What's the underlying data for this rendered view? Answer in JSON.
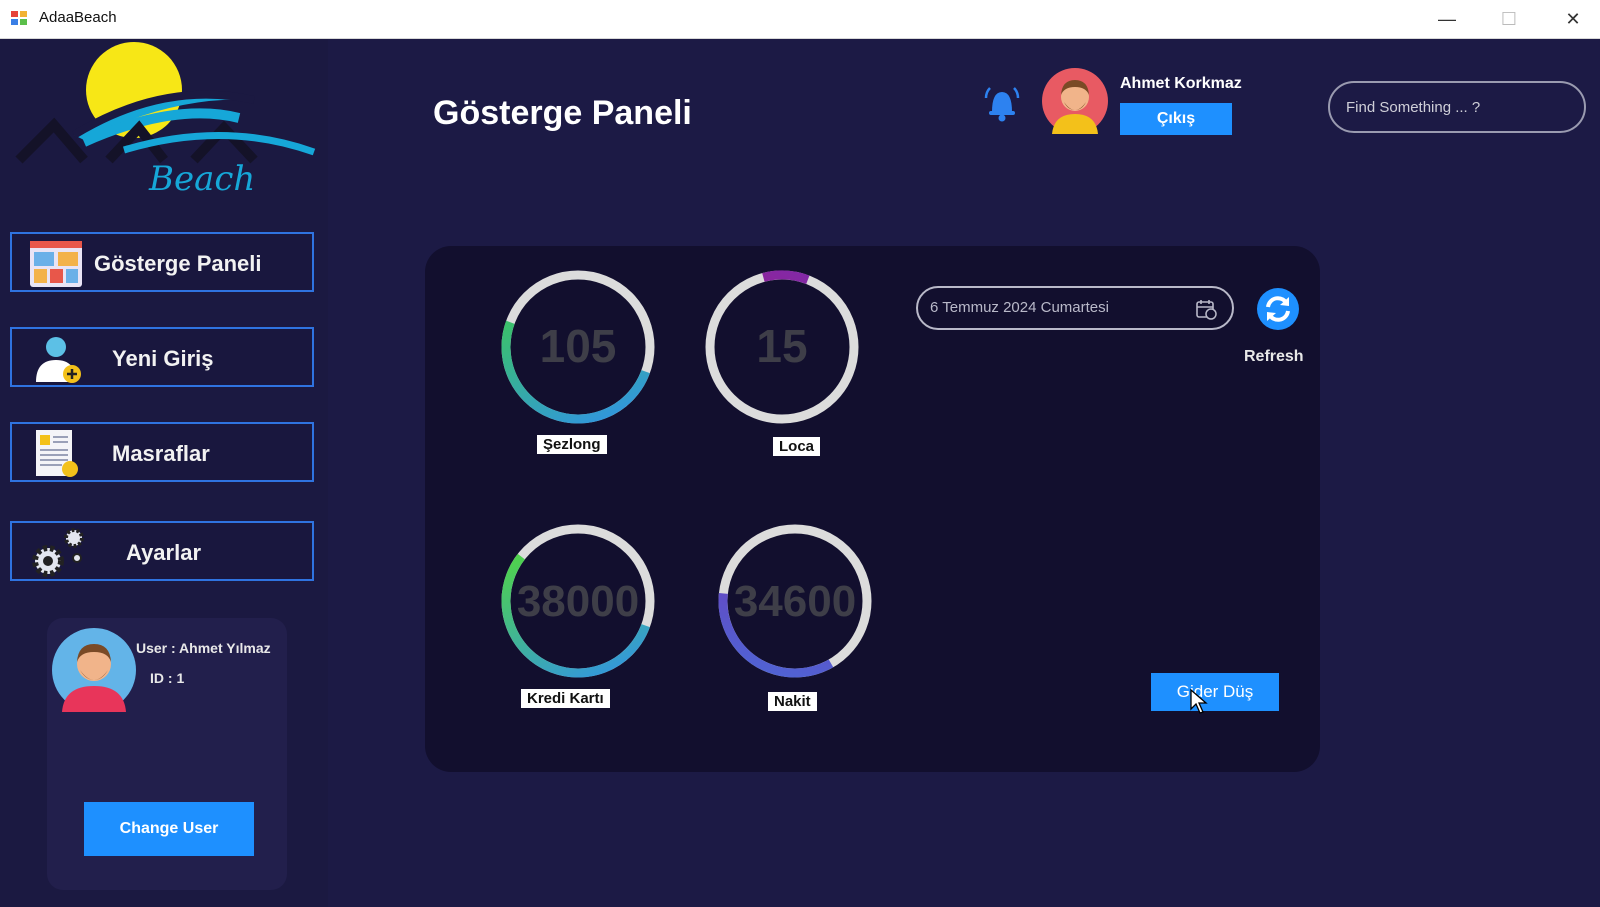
{
  "window": {
    "title": "AdaaBeach",
    "controls": {
      "minimize": "—",
      "maximize": "☐",
      "close": "✕"
    }
  },
  "sidebar": {
    "logo_text": "Beach",
    "nav": [
      {
        "label": "Gösterge Paneli",
        "icon": "dashboard-icon"
      },
      {
        "label": "Yeni Giriş",
        "icon": "add-user-icon"
      },
      {
        "label": "Masraflar",
        "icon": "document-icon"
      },
      {
        "label": "Ayarlar",
        "icon": "gear-icon"
      }
    ],
    "user_card": {
      "user_line": "User : Ahmet Yılmaz",
      "id_line": "ID : 1",
      "change_user": "Change User"
    }
  },
  "header": {
    "page_title": "Gösterge Paneli",
    "user_name": "Ahmet Korkmaz",
    "logout": "Çıkış",
    "search_placeholder": "Find Something ... ?"
  },
  "dashboard": {
    "gauges": [
      {
        "label": "Şezlong",
        "value": "105",
        "progress": 0.5,
        "colors": [
          "#3fd13f",
          "#2f8ff0"
        ]
      },
      {
        "label": "Loca",
        "value": "15",
        "progress": 0.1,
        "colors": [
          "#b3186b",
          "#7b2bb0"
        ]
      },
      {
        "label": "Kredi Kartı",
        "value": "38000",
        "progress": 0.55,
        "colors": [
          "#56e02a",
          "#2f8ff0"
        ]
      },
      {
        "label": "Nakit",
        "value": "34600",
        "progress": 0.35,
        "colors": [
          "#7b2bb0",
          "#4a6ad8"
        ]
      }
    ],
    "date": "6 Temmuz 2024 Cumartesi",
    "refresh_label": "Refresh",
    "gider_button": "Gider Düş"
  },
  "colors": {
    "background": "#1c1a45",
    "panel": "#120f2e",
    "accent": "#1e90ff",
    "nav_border": "#2f73e0"
  }
}
